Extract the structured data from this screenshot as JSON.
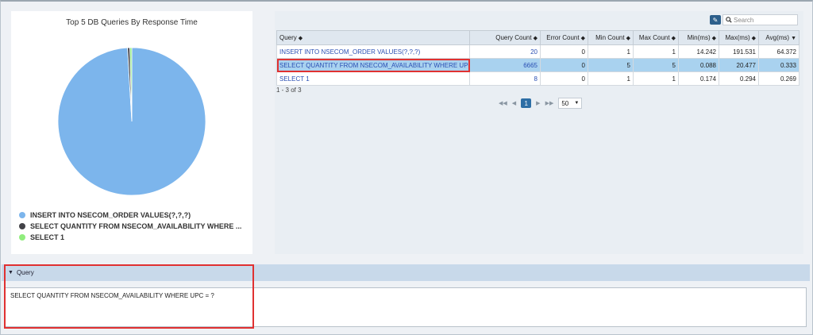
{
  "chart_data": {
    "type": "pie",
    "title": "Top 5 DB Queries By Response Time",
    "slices": [
      {
        "label": "INSERT INTO NSECOM_ORDER VALUES(?,?,?)",
        "value": 64.372,
        "color": "#7cb5ec"
      },
      {
        "label": "SELECT QUANTITY FROM NSECOM_AVAILABILITY WHERE ...",
        "value": 0.333,
        "color": "#434348"
      },
      {
        "label": "SELECT 1",
        "value": 0.269,
        "color": "#90ed7d"
      }
    ]
  },
  "toolbar": {
    "export_icon": "export-icon",
    "search_placeholder": "Search"
  },
  "table": {
    "columns": [
      "Query",
      "Query Count",
      "Error Count",
      "Min Count",
      "Max Count",
      "Min(ms)",
      "Max(ms)",
      "Avg(ms)"
    ],
    "rows": [
      [
        "INSERT INTO NSECOM_ORDER VALUES(?,?,?)",
        "20",
        "0",
        "1",
        "1",
        "14.242",
        "191.531",
        "64.372"
      ],
      [
        "SELECT QUANTITY FROM NSECOM_AVAILABILITY WHERE UPC",
        "6665",
        "0",
        "5",
        "5",
        "0.088",
        "20.477",
        "0.333"
      ],
      [
        "SELECT 1",
        "8",
        "0",
        "1",
        "1",
        "0.174",
        "0.294",
        "0.269"
      ]
    ],
    "selected_row": 1,
    "records_text": "1 - 3 of 3"
  },
  "pager": {
    "current_page": "1",
    "page_size": "50"
  },
  "query": {
    "header": "Query",
    "text": "SELECT QUANTITY FROM NSECOM_AVAILABILITY  WHERE UPC = ?"
  }
}
